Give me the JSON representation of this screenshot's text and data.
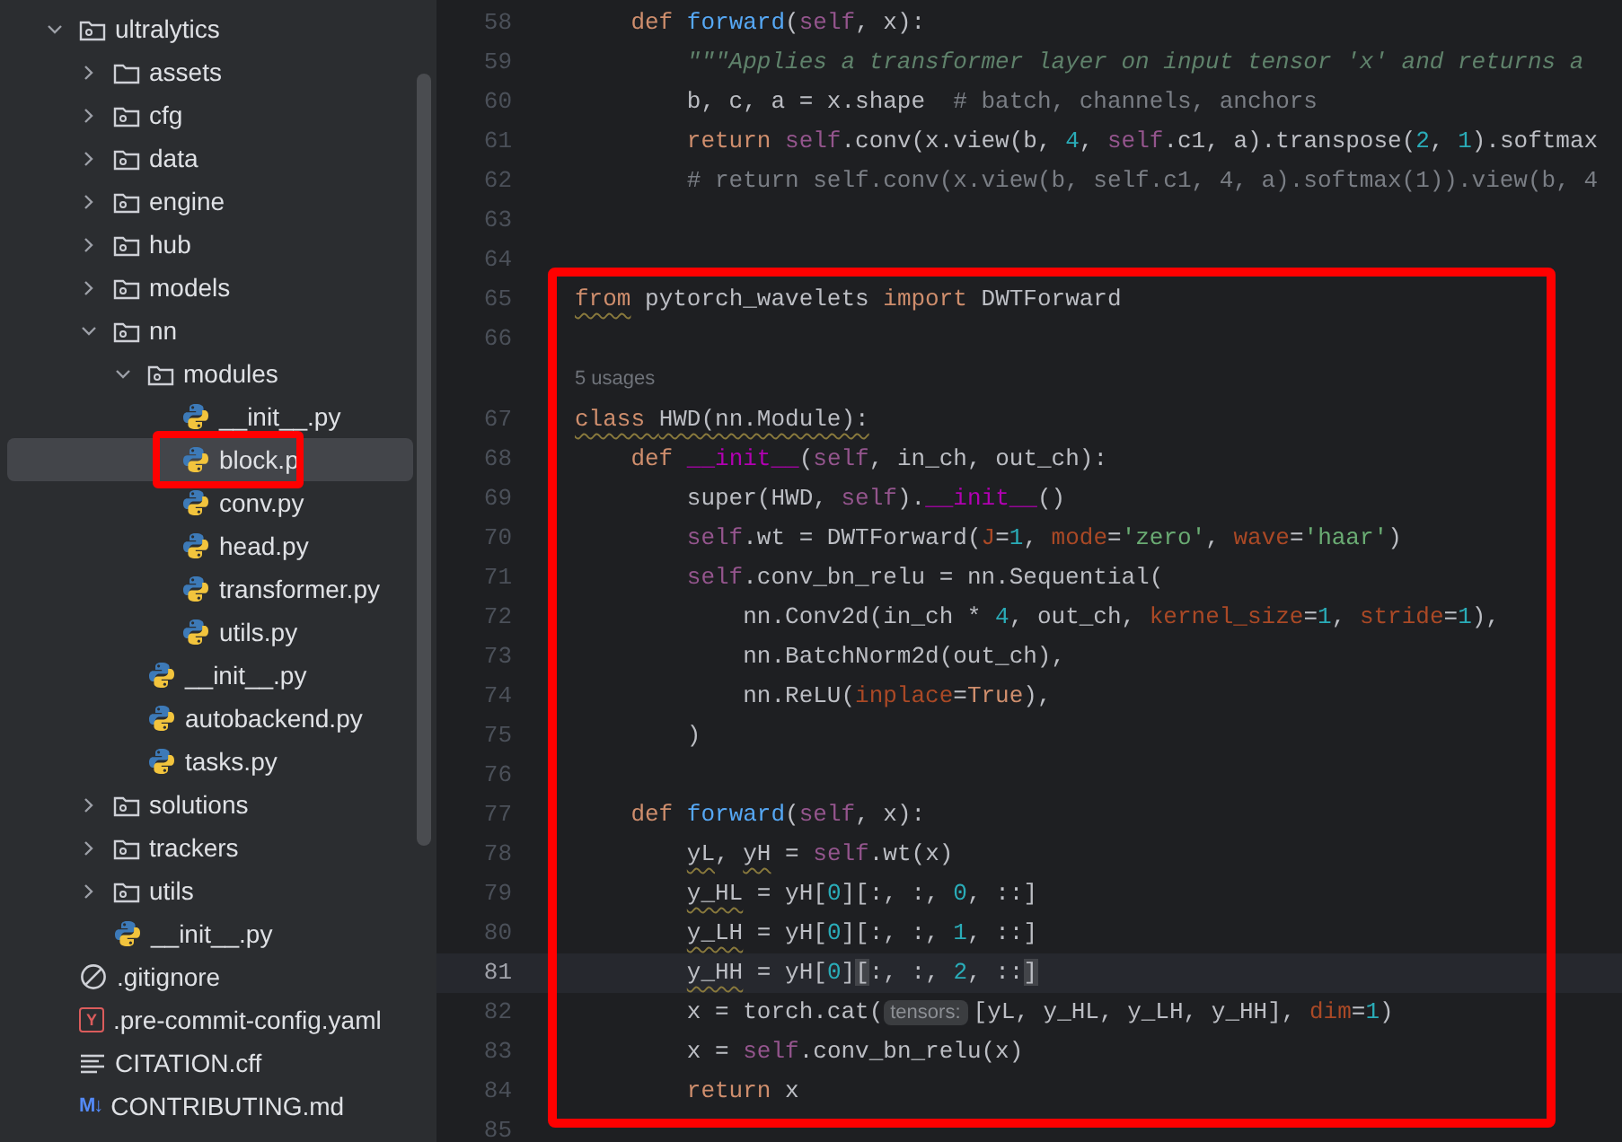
{
  "project_tree": {
    "items": [
      {
        "label": "ultralytics",
        "kind": "package",
        "expanded": true,
        "selected": false,
        "outlined": false,
        "children": [
          {
            "label": "assets",
            "kind": "folder",
            "expanded": false,
            "selected": false,
            "outlined": false
          },
          {
            "label": "cfg",
            "kind": "package",
            "expanded": false,
            "selected": false,
            "outlined": false
          },
          {
            "label": "data",
            "kind": "package",
            "expanded": false,
            "selected": false,
            "outlined": false
          },
          {
            "label": "engine",
            "kind": "package",
            "expanded": false,
            "selected": false,
            "outlined": false
          },
          {
            "label": "hub",
            "kind": "package",
            "expanded": false,
            "selected": false,
            "outlined": false
          },
          {
            "label": "models",
            "kind": "package",
            "expanded": false,
            "selected": false,
            "outlined": false
          },
          {
            "label": "nn",
            "kind": "package",
            "expanded": true,
            "selected": false,
            "outlined": false,
            "children": [
              {
                "label": "modules",
                "kind": "package",
                "expanded": true,
                "selected": false,
                "outlined": false,
                "children": [
                  {
                    "label": "__init__.py",
                    "kind": "python",
                    "selected": false,
                    "outlined": false
                  },
                  {
                    "label": "block.p",
                    "kind": "python",
                    "selected": true,
                    "outlined": true
                  },
                  {
                    "label": "conv.py",
                    "kind": "python",
                    "selected": false,
                    "outlined": false
                  },
                  {
                    "label": "head.py",
                    "kind": "python",
                    "selected": false,
                    "outlined": false
                  },
                  {
                    "label": "transformer.py",
                    "kind": "python",
                    "selected": false,
                    "outlined": false
                  },
                  {
                    "label": "utils.py",
                    "kind": "python",
                    "selected": false,
                    "outlined": false
                  }
                ]
              },
              {
                "label": "__init__.py",
                "kind": "python",
                "selected": false,
                "outlined": false
              },
              {
                "label": "autobackend.py",
                "kind": "python",
                "selected": false,
                "outlined": false
              },
              {
                "label": "tasks.py",
                "kind": "python",
                "selected": false,
                "outlined": false
              }
            ]
          },
          {
            "label": "solutions",
            "kind": "package",
            "expanded": false,
            "selected": false,
            "outlined": false
          },
          {
            "label": "trackers",
            "kind": "package",
            "expanded": false,
            "selected": false,
            "outlined": false
          },
          {
            "label": "utils",
            "kind": "package",
            "expanded": false,
            "selected": false,
            "outlined": false
          },
          {
            "label": "__init__.py",
            "kind": "python",
            "selected": false,
            "outlined": false
          }
        ]
      },
      {
        "label": ".gitignore",
        "kind": "ignore",
        "selected": false,
        "outlined": false
      },
      {
        "label": ".pre-commit-config.yaml",
        "kind": "yaml",
        "icon_label": "Y",
        "selected": false,
        "outlined": false
      },
      {
        "label": "CITATION.cff",
        "kind": "text",
        "selected": false,
        "outlined": false
      },
      {
        "label": "CONTRIBUTING.md",
        "kind": "markdown",
        "icon_label": "M↓",
        "selected": false,
        "outlined": false
      }
    ]
  },
  "editor": {
    "groups": [
      {
        "outlined": false,
        "lines": [
          {
            "number": "58",
            "current": false,
            "tokens": [
              {
                "text": "    def ",
                "kind": "keyword"
              },
              {
                "text": "forward",
                "kind": "function"
              },
              {
                "text": "(",
                "kind": "plain"
              },
              {
                "text": "self",
                "kind": "self"
              },
              {
                "text": ", x):",
                "kind": "plain"
              }
            ]
          },
          {
            "number": "59",
            "current": false,
            "tokens": [
              {
                "text": "        \"\"\"Applies a transformer layer on input tensor 'x' and returns a",
                "kind": "docstring"
              }
            ]
          },
          {
            "number": "60",
            "current": false,
            "tokens": [
              {
                "text": "        b, c, a = x.shape  ",
                "kind": "plain"
              },
              {
                "text": "# batch, channels, anchors",
                "kind": "comment"
              }
            ]
          },
          {
            "number": "61",
            "current": false,
            "tokens": [
              {
                "text": "        return ",
                "kind": "keyword"
              },
              {
                "text": "self",
                "kind": "self"
              },
              {
                "text": ".conv(x.view(b, ",
                "kind": "plain"
              },
              {
                "text": "4",
                "kind": "number"
              },
              {
                "text": ", ",
                "kind": "plain"
              },
              {
                "text": "self",
                "kind": "self"
              },
              {
                "text": ".c1, a).transpose(",
                "kind": "plain"
              },
              {
                "text": "2",
                "kind": "number"
              },
              {
                "text": ", ",
                "kind": "plain"
              },
              {
                "text": "1",
                "kind": "number"
              },
              {
                "text": ").softmax",
                "kind": "plain"
              }
            ]
          },
          {
            "number": "62",
            "current": false,
            "tokens": [
              {
                "text": "        # return self.conv(x.view(b, self.c1, 4, a).softmax(1)).view(b, 4",
                "kind": "comment"
              }
            ]
          },
          {
            "number": "63",
            "current": false
          },
          {
            "number": "64",
            "current": false
          }
        ]
      },
      {
        "outlined": true,
        "lines": [
          {
            "number": "65",
            "current": false,
            "tokens": [
              {
                "text": "from",
                "kind": "keyword",
                "warning": true
              },
              {
                "text": " pytorch_wavelets ",
                "kind": "plain"
              },
              {
                "text": "import ",
                "kind": "keyword"
              },
              {
                "text": "DWTForward",
                "kind": "plain"
              }
            ]
          },
          {
            "number": "66",
            "current": false
          },
          {
            "number": "67",
            "current": false,
            "inlay_above": "5 usages",
            "tokens": [
              {
                "text": "class ",
                "kind": "keyword",
                "warning": true
              },
              {
                "text": "HWD(nn.Module):",
                "kind": "plain",
                "warning": true
              }
            ]
          },
          {
            "number": "68",
            "current": false,
            "tokens": [
              {
                "text": "    def ",
                "kind": "keyword"
              },
              {
                "text": "__init__",
                "kind": "magic"
              },
              {
                "text": "(",
                "kind": "plain"
              },
              {
                "text": "self",
                "kind": "self"
              },
              {
                "text": ", in_ch, out_ch):",
                "kind": "plain"
              }
            ]
          },
          {
            "number": "69",
            "current": false,
            "tokens": [
              {
                "text": "        super(HWD, ",
                "kind": "plain"
              },
              {
                "text": "self",
                "kind": "self"
              },
              {
                "text": ").",
                "kind": "plain"
              },
              {
                "text": "__init__",
                "kind": "magic"
              },
              {
                "text": "()",
                "kind": "plain"
              }
            ]
          },
          {
            "number": "70",
            "current": false,
            "tokens": [
              {
                "text": "        self",
                "kind": "self"
              },
              {
                "text": ".wt = DWTForward(",
                "kind": "plain"
              },
              {
                "text": "J",
                "kind": "param"
              },
              {
                "text": "=",
                "kind": "plain"
              },
              {
                "text": "1",
                "kind": "number"
              },
              {
                "text": ", ",
                "kind": "plain"
              },
              {
                "text": "mode",
                "kind": "param"
              },
              {
                "text": "=",
                "kind": "plain"
              },
              {
                "text": "'zero'",
                "kind": "string"
              },
              {
                "text": ", ",
                "kind": "plain"
              },
              {
                "text": "wave",
                "kind": "param"
              },
              {
                "text": "=",
                "kind": "plain"
              },
              {
                "text": "'haar'",
                "kind": "string"
              },
              {
                "text": ")",
                "kind": "plain"
              }
            ]
          },
          {
            "number": "71",
            "current": false,
            "tokens": [
              {
                "text": "        self",
                "kind": "self"
              },
              {
                "text": ".conv_bn_relu = nn.Sequential(",
                "kind": "plain"
              }
            ]
          },
          {
            "number": "72",
            "current": false,
            "tokens": [
              {
                "text": "            nn.Conv2d(in_ch * ",
                "kind": "plain"
              },
              {
                "text": "4",
                "kind": "number"
              },
              {
                "text": ", out_ch, ",
                "kind": "plain"
              },
              {
                "text": "kernel_size",
                "kind": "param"
              },
              {
                "text": "=",
                "kind": "plain"
              },
              {
                "text": "1",
                "kind": "number"
              },
              {
                "text": ", ",
                "kind": "plain"
              },
              {
                "text": "stride",
                "kind": "param"
              },
              {
                "text": "=",
                "kind": "plain"
              },
              {
                "text": "1",
                "kind": "number"
              },
              {
                "text": "),",
                "kind": "plain"
              }
            ]
          },
          {
            "number": "73",
            "current": false,
            "tokens": [
              {
                "text": "            nn.BatchNorm2d(out_ch),",
                "kind": "plain"
              }
            ]
          },
          {
            "number": "74",
            "current": false,
            "tokens": [
              {
                "text": "            nn.ReLU(",
                "kind": "plain"
              },
              {
                "text": "inplace",
                "kind": "param"
              },
              {
                "text": "=",
                "kind": "plain"
              },
              {
                "text": "True",
                "kind": "keyword"
              },
              {
                "text": "),",
                "kind": "plain"
              }
            ]
          },
          {
            "number": "75",
            "current": false,
            "tokens": [
              {
                "text": "        )",
                "kind": "plain"
              }
            ]
          },
          {
            "number": "76",
            "current": false
          },
          {
            "number": "77",
            "current": false,
            "tokens": [
              {
                "text": "    def ",
                "kind": "keyword"
              },
              {
                "text": "forward",
                "kind": "function"
              },
              {
                "text": "(",
                "kind": "plain"
              },
              {
                "text": "self",
                "kind": "self"
              },
              {
                "text": ", x):",
                "kind": "plain"
              }
            ]
          },
          {
            "number": "78",
            "current": false,
            "tokens": [
              {
                "text": "        yL",
                "kind": "plain",
                "warning": true
              },
              {
                "text": ", ",
                "kind": "plain"
              },
              {
                "text": "yH",
                "kind": "plain",
                "warning": true
              },
              {
                "text": " = ",
                "kind": "plain"
              },
              {
                "text": "self",
                "kind": "self"
              },
              {
                "text": ".wt(x)",
                "kind": "plain"
              }
            ]
          },
          {
            "number": "79",
            "current": false,
            "tokens": [
              {
                "text": "        y_HL",
                "kind": "plain",
                "warning": true
              },
              {
                "text": " = yH[",
                "kind": "plain"
              },
              {
                "text": "0",
                "kind": "number"
              },
              {
                "text": "][:, :, ",
                "kind": "plain"
              },
              {
                "text": "0",
                "kind": "number"
              },
              {
                "text": ", ::]",
                "kind": "plain"
              }
            ]
          },
          {
            "number": "80",
            "current": false,
            "tokens": [
              {
                "text": "        y_LH",
                "kind": "plain",
                "warning": true
              },
              {
                "text": " = yH[",
                "kind": "plain"
              },
              {
                "text": "0",
                "kind": "number"
              },
              {
                "text": "][:, :, ",
                "kind": "plain"
              },
              {
                "text": "1",
                "kind": "number"
              },
              {
                "text": ", ::]",
                "kind": "plain"
              }
            ]
          },
          {
            "number": "81",
            "current": true,
            "tokens": [
              {
                "text": "        y_HH",
                "kind": "plain",
                "warning": true
              },
              {
                "text": " = yH[",
                "kind": "plain"
              },
              {
                "text": "0",
                "kind": "number"
              },
              {
                "text": "]",
                "kind": "plain"
              },
              {
                "text": "[",
                "kind": "plain",
                "matched": true
              },
              {
                "text": ":, :, ",
                "kind": "plain"
              },
              {
                "text": "2",
                "kind": "number"
              },
              {
                "text": ", ::",
                "kind": "plain"
              },
              {
                "text": "]",
                "kind": "plain",
                "matched": true
              }
            ]
          },
          {
            "number": "82",
            "current": false,
            "tokens": [
              {
                "text": "        x = torch.cat(",
                "kind": "plain"
              },
              {
                "text": "tensors:",
                "kind": "hint"
              },
              {
                "text": "[yL, y_HL, y_LH, y_HH], ",
                "kind": "plain"
              },
              {
                "text": "dim",
                "kind": "param"
              },
              {
                "text": "=",
                "kind": "plain"
              },
              {
                "text": "1",
                "kind": "number"
              },
              {
                "text": ")",
                "kind": "plain"
              }
            ]
          },
          {
            "number": "83",
            "current": false,
            "tokens": [
              {
                "text": "        x = ",
                "kind": "plain"
              },
              {
                "text": "self",
                "kind": "self"
              },
              {
                "text": ".conv_bn_relu(x)",
                "kind": "plain"
              }
            ]
          },
          {
            "number": "84",
            "current": false,
            "tokens": [
              {
                "text": "        return ",
                "kind": "keyword"
              },
              {
                "text": "x",
                "kind": "plain"
              }
            ]
          }
        ]
      },
      {
        "outlined": false,
        "lines": [
          {
            "number": "85",
            "current": false
          }
        ]
      }
    ]
  }
}
